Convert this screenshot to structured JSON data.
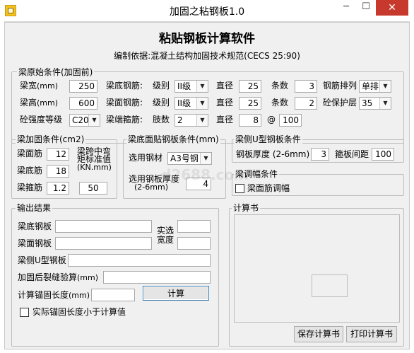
{
  "window": {
    "title": "加固之粘钢板1.0",
    "minimize": "─",
    "maximize": "☐",
    "close": "✕"
  },
  "header": {
    "title": "粘贴钢板计算软件",
    "basis": "编制依据:混凝土结构加固技术规范(CECS 25:90)"
  },
  "original": {
    "group_title": "梁原始条件(加固前)",
    "width_label": "梁宽",
    "width_unit": "(mm)",
    "width_value": "250",
    "height_label": "梁高",
    "height_unit": "(mm)",
    "height_value": "600",
    "concrete_label": "砼强度等级",
    "concrete_value": "C20",
    "bottom_bar_label": "梁底钢筋:",
    "top_bar_label": "梁面钢筋:",
    "stirrup_label": "梁端箍筋:",
    "grade_label": "级别",
    "diameter_label": "直径",
    "count_label": "条数",
    "legs_label": "肢数",
    "at_label": "@",
    "bottom_grade": "II级",
    "bottom_diameter": "25",
    "bottom_count": "3",
    "top_grade": "II级",
    "top_diameter": "25",
    "top_count": "2",
    "stirrup_legs": "2",
    "stirrup_diameter": "8",
    "stirrup_spacing": "100",
    "arrangement_label": "钢筋排列",
    "arrangement_value": "单排",
    "cover_label": "砼保护层",
    "cover_value": "35"
  },
  "reinforce": {
    "group_title": "梁加固条件(cm2)",
    "top_label": "梁面筋",
    "top_value": "12",
    "bottom_label": "梁底筋",
    "bottom_value": "18",
    "stirrup_label": "梁箍筋",
    "stirrup_value": "1.2",
    "moment_label_1": "梁跨中弯",
    "moment_label_2": "矩标准值",
    "moment_label_3": "(KN.mm)",
    "moment_value": "50"
  },
  "bottom_plate": {
    "group_title": "梁底面贴钢板条件(mm)",
    "material_label": "选用钢材",
    "material_value": "A3号钢",
    "thickness_label": "选用钢板厚度",
    "thickness_range": "(2-6mm)",
    "thickness_value": "4"
  },
  "side_plate": {
    "group_title": "梁侧U型钢板条件",
    "thickness_label": "钢板厚度 (2-6mm)",
    "thickness_value": "3",
    "hoop_label": "箍板间距",
    "hoop_value": "100"
  },
  "adjust": {
    "group_title": "梁调幅条件",
    "checkbox_label": "梁面筋调幅"
  },
  "output": {
    "group_title": "输出结果",
    "bottom_plate_label": "梁底钢板",
    "top_plate_label": "梁面钢板",
    "side_plate_label": "梁侧U型钢板",
    "crack_label": "加固后裂缝验算",
    "crack_unit": "(mm)",
    "anchor_label": "计算锚固长度",
    "anchor_unit": "(mm)",
    "actual_label_1": "实选",
    "actual_label_2": "宽度",
    "calculate_button": "计算",
    "anchor_checkbox_label": "实际锚固长度小于计算值"
  },
  "report": {
    "group_title": "计算书",
    "save_button": "保存计算书",
    "print_button": "打印计算书"
  },
  "watermark": "d2688.com"
}
